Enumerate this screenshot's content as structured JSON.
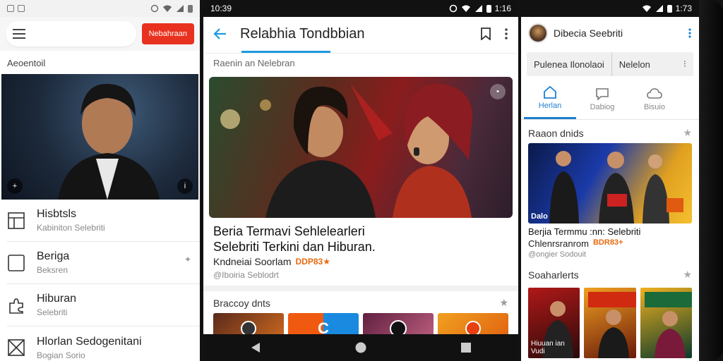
{
  "phone1": {
    "status_icons": [
      "image-icon",
      "gallery-icon",
      "sync-icon",
      "wifi-icon",
      "signal-icon",
      "battery-icon"
    ],
    "action_button_label": "Nebahraan",
    "section_title": "Aeoentoil",
    "list_items": [
      {
        "title": "Hisbtsls",
        "subtitle": "Kabiniton Selebriti",
        "icon": "window-icon"
      },
      {
        "title": "Beriga",
        "subtitle": "Beksren",
        "icon": "square-icon"
      },
      {
        "title": "Hiburan",
        "subtitle": "Selebriti",
        "icon": "puzzle-icon"
      },
      {
        "title": "Hlorlan Sedogenitani",
        "subtitle": "Bogian Sorio",
        "icon": "image-x-icon"
      }
    ],
    "colors": {
      "accent": "#e8321f"
    }
  },
  "phone2": {
    "time": "10:39",
    "time_right": "1:16",
    "title": "Relabhia Tondbbian",
    "subheading": "Raenin an Nelebran",
    "article": {
      "headline_line1": "Beria Termavi Sehlelearleri",
      "headline_line2": "Selebriti Terkini dan Hiburan.",
      "meta": "Kndneiai Soorlam",
      "badge": "DDP83★",
      "source": "@Iboiria Seblodrt"
    },
    "section_title": "Braccoy dnts",
    "colors": {
      "accent": "#1e9be0",
      "badge": "#e86a10"
    }
  },
  "phone3": {
    "time": "1:73",
    "title": "Dibecia Seebriti",
    "search_left": "Pulenea Ilonolaoi",
    "search_right": "Nelelon",
    "tabs": [
      {
        "label": "Herlan",
        "icon": "home-icon",
        "active": true
      },
      {
        "label": "Dabiog",
        "icon": "chat-icon",
        "active": false
      },
      {
        "label": "Bisuio",
        "icon": "cloud-icon",
        "active": false
      }
    ],
    "section1_title": "Raaon dnids",
    "card_label": "Dalo",
    "headline": "Berjia Termmu :nn: Selebriti",
    "meta": "Chlenrsranrom",
    "badge": "BDR83+",
    "source": "@ongier Sodouit",
    "section2_title": "Soaharlerts",
    "thumbs": [
      "Hiuuan ian Vudi",
      "",
      ""
    ],
    "colors": {
      "accent": "#1e7fd0"
    }
  }
}
